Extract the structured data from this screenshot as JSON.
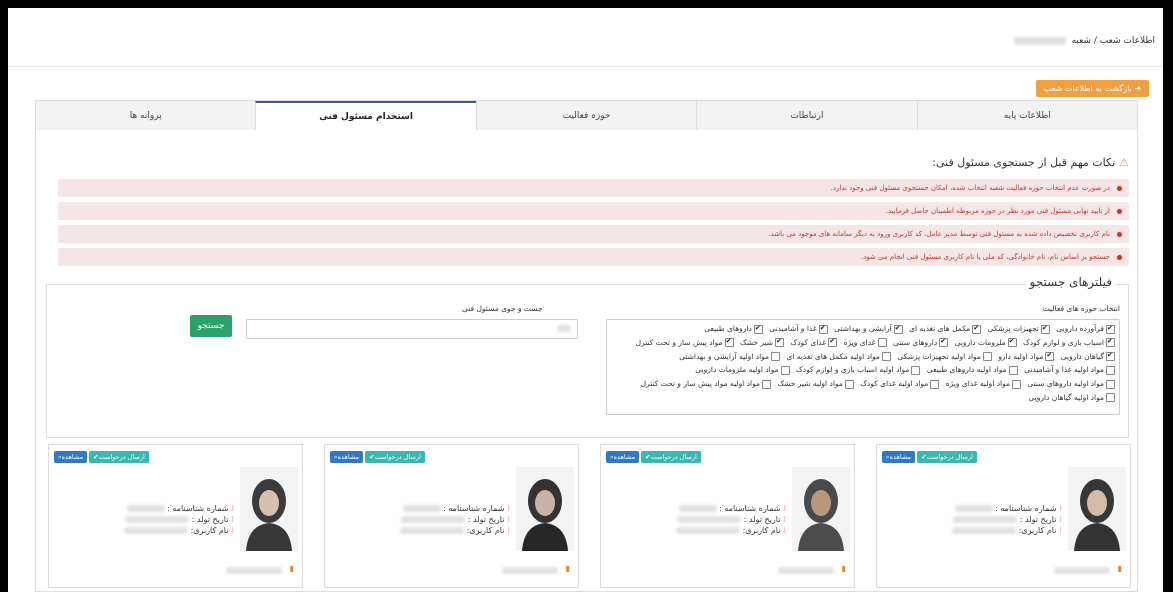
{
  "breadcrumb": {
    "path": "اطلاعات شعب / شعبه"
  },
  "back_button": {
    "label": "بازگشت به اطلاعات شعب",
    "icon": "arrow-right-icon"
  },
  "tabs": [
    {
      "label": "اطلاعات پایه",
      "active": false
    },
    {
      "label": "ارتباطات",
      "active": false
    },
    {
      "label": "حوزه فعالیت",
      "active": false
    },
    {
      "label": "استخدام مسئول فنی",
      "active": true
    },
    {
      "label": "پروانه ها",
      "active": false
    }
  ],
  "notes": {
    "title": "نکات مهم قبل از جستجوی مسئول فنی:",
    "items": [
      "در صورت عدم انتخاب حوزه فعالیت شعبه انتخاب شده، امکان جستجوی مسئول فنی وجود ندارد.",
      "از تایید نهایی مسئول فنی مورد نظر در حوزه مربوطه اطمینان حاصل فرمایید.",
      "نام کاربری تخصیص داده شده به مسئول فنی توسط مدیر عامل، کد کاربری ورود به دیگر سامانه های موجود می باشد.",
      "جستجو بر اساس نام، نام خانوادگی، کد ملی یا نام کاربری مسئول فنی انجام می شود."
    ]
  },
  "filters": {
    "legend": "فیلترهای جستجو",
    "activity_label": "انتخاب حوزه های فعالیت",
    "search_label": "جست و جوی مسئول فنی",
    "search_button": "جستجو",
    "activities": [
      {
        "label": "فرآورده دارویی",
        "checked": true
      },
      {
        "label": "تجهیزات پزشکی",
        "checked": true
      },
      {
        "label": "مکمل های تغذیه ای",
        "checked": true
      },
      {
        "label": "آرایشی و بهداشتی",
        "checked": true
      },
      {
        "label": "غذا و آشامیدنی",
        "checked": true
      },
      {
        "label": "داروهای طبیعی",
        "checked": true
      },
      {
        "label": "اسباب بازی و لوازم کودک",
        "checked": true
      },
      {
        "label": "ملزومات دارویی",
        "checked": true
      },
      {
        "label": "داروهای سنتی",
        "checked": true
      },
      {
        "label": "غذای ویژه",
        "checked": false
      },
      {
        "label": "غذای کودک",
        "checked": true
      },
      {
        "label": "شیر خشک",
        "checked": true
      },
      {
        "label": "مواد پیش ساز و تحت کنترل",
        "checked": true
      },
      {
        "label": "گیاهان دارویی",
        "checked": true
      },
      {
        "label": "مواد اولیه دارو",
        "checked": true
      },
      {
        "label": "مواد اولیه تجهیزات پزشکی",
        "checked": false
      },
      {
        "label": "مواد اولیه مکمل های تغذیه ای",
        "checked": false
      },
      {
        "label": "مواد اولیه آرایشی و بهداشتی",
        "checked": false
      },
      {
        "label": "مواد اولیه غذا و آشامیدنی",
        "checked": false
      },
      {
        "label": "مواد اولیه داروهای طبیعی",
        "checked": false
      },
      {
        "label": "مواد اولیه اسباب بازی و لوازم کودک",
        "checked": false
      },
      {
        "label": "مواد اولیه ملزومات دارویی",
        "checked": false
      },
      {
        "label": "مواد اولیه داروهای سنتی",
        "checked": false
      },
      {
        "label": "مواد اولیه غذای ویژه",
        "checked": false
      },
      {
        "label": "مواد اولیه غذای کودک",
        "checked": false
      },
      {
        "label": "مواد اولیه شیر خشک",
        "checked": false
      },
      {
        "label": "مواد اولیه مواد پیش ساز و تحت کنترل",
        "checked": false
      },
      {
        "label": "مواد اولیه گیاهان دارویی",
        "checked": false
      }
    ]
  },
  "card_labels": {
    "send_request": "ارسال درخواست",
    "view": "مشاهده",
    "id_number": "شماره شناسنامه :",
    "birth_date": "تاریخ تولد :",
    "username": "نام کاربری:"
  },
  "colors": {
    "accent": "#3a5b8c",
    "back_button": "#f0a040",
    "search_button": "#2aa36b",
    "send": "#3bb6b0",
    "view": "#3079c3",
    "note_text": "#c0392b",
    "note_bg": "#f4e6e6"
  }
}
